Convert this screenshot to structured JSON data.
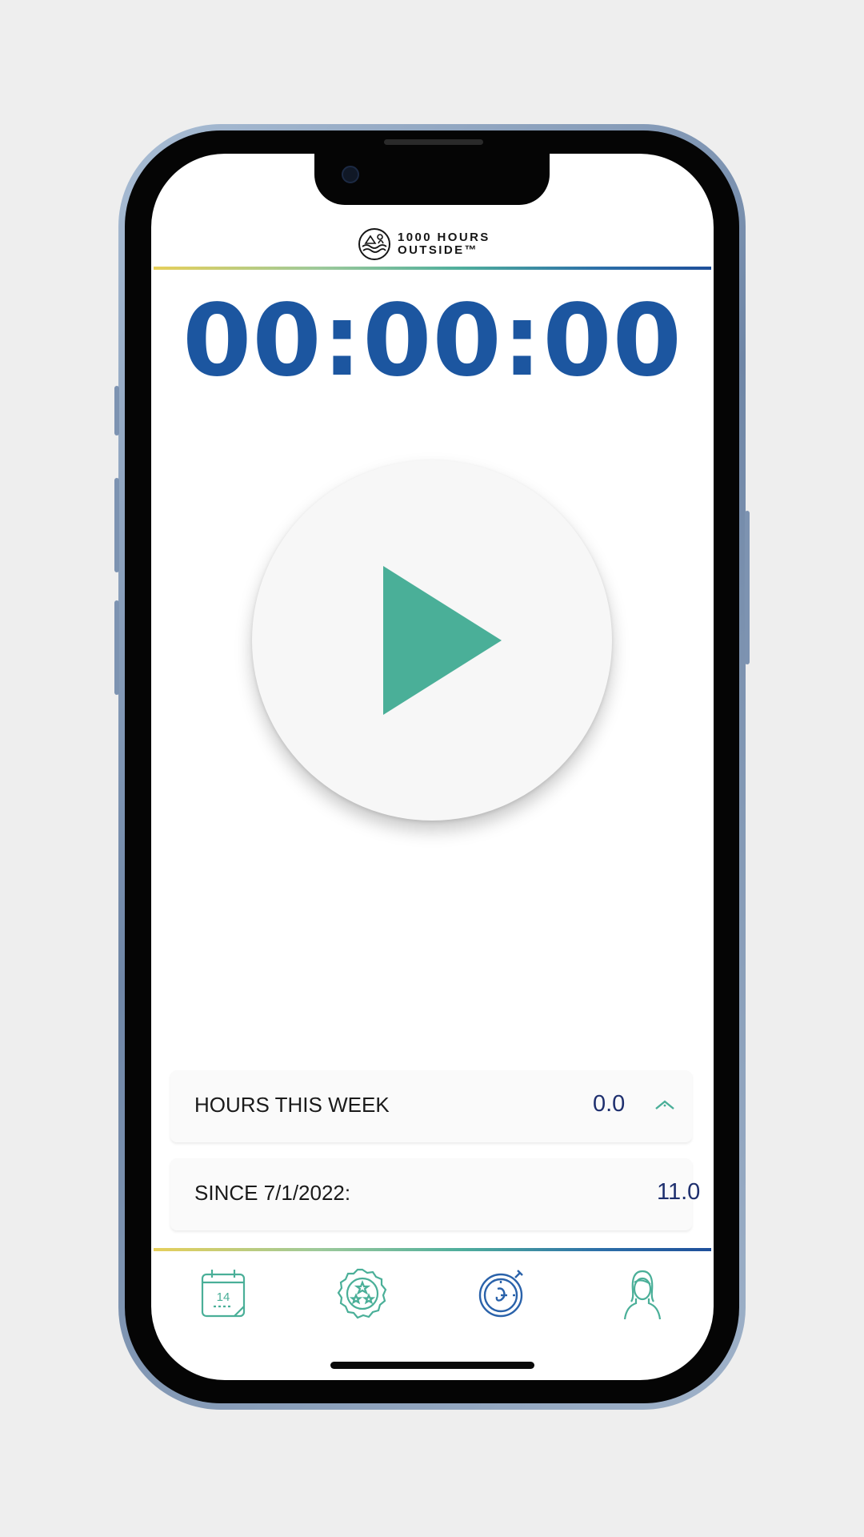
{
  "brand": {
    "line1": "1000 HOURS",
    "line2": "OUTSIDE™"
  },
  "timer": {
    "display": "00:00:00"
  },
  "play": {
    "state": "stopped",
    "icon": "play-icon"
  },
  "stats": {
    "week": {
      "label": "HOURS THIS WEEK",
      "value": "0.0",
      "toggle_icon": "chevron-up-icon"
    },
    "since": {
      "label": "SINCE 7/1/2022:",
      "value": "11.0"
    }
  },
  "tabs": [
    {
      "name": "calendar",
      "icon": "calendar-icon",
      "day": "14"
    },
    {
      "name": "badges",
      "icon": "badge-icon"
    },
    {
      "name": "timer",
      "icon": "stopwatch-icon",
      "active": true
    },
    {
      "name": "profile",
      "icon": "person-icon"
    }
  ],
  "colors": {
    "timer": "#1c56a0",
    "accent_green": "#4aaf98",
    "value_navy": "#1e2f6e",
    "gradient": [
      "#e6cf5a",
      "#4fae9c",
      "#1e4f9a"
    ]
  }
}
